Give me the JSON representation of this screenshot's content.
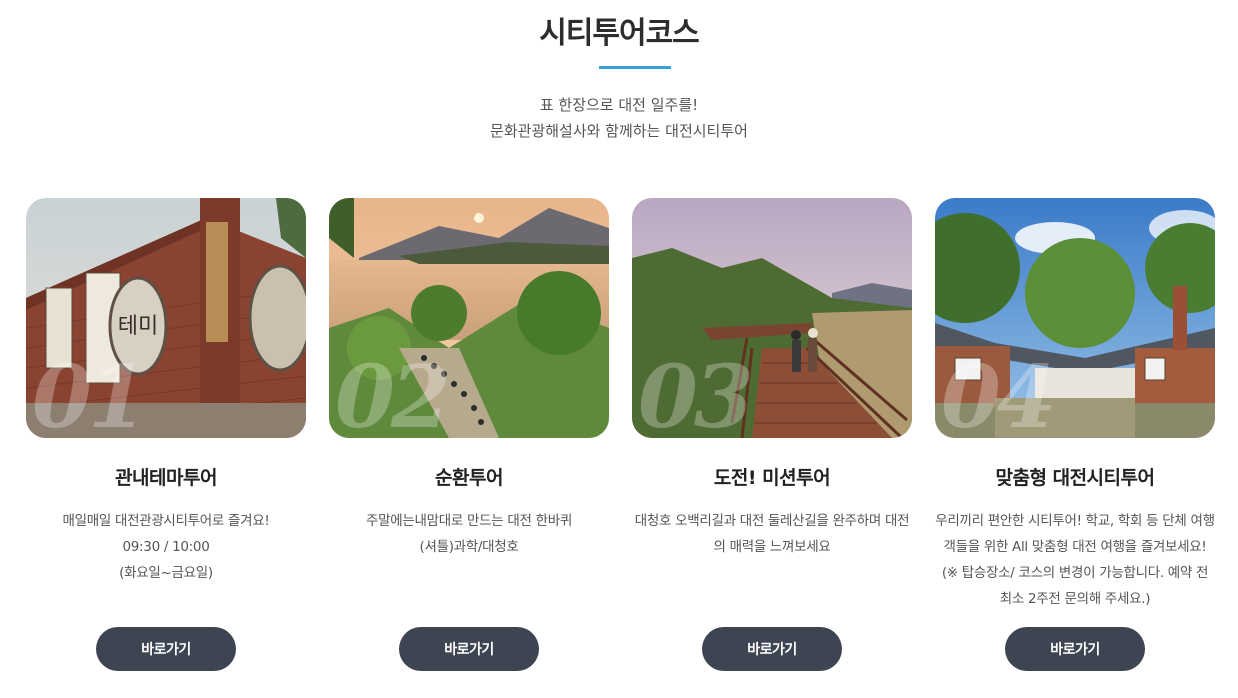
{
  "section": {
    "title": "시티투어코스",
    "subtitle_line1": "표 한장으로 대전 일주를!",
    "subtitle_line2": "문화관광해설사와 함께하는 대전시티투어"
  },
  "accent_color": "#3aa0de",
  "button_color": "#3d4452",
  "courses": [
    {
      "number": "01",
      "title": "관내테마투어",
      "desc": [
        "매일매일 대전관광시티투어로 즐겨요!",
        "09:30 / 10:00",
        "(화요일~금요일)"
      ],
      "button": "바로가기"
    },
    {
      "number": "02",
      "title": "순환투어",
      "desc": [
        "주말에는내맘대로 만드는 대전 한바퀴",
        "(셔틀)과학/대청호"
      ],
      "button": "바로가기"
    },
    {
      "number": "03",
      "title": "도전! 미션투어",
      "desc": [
        "대청호 오백리길과 대전 둘레산길을 완주하며 대전",
        "의 매력을 느껴보세요"
      ],
      "button": "바로가기"
    },
    {
      "number": "04",
      "title": "맞춤형 대전시티투어",
      "desc": [
        "우리끼리 편안한 시티투어! 학교, 학회 등 단체 여행",
        "객들을 위한 All 맞춤형 대전 여행을 즐겨보세요!",
        "(※ 탑승장소/ 코스의 변경이 가능합니다. 예약 전",
        "최소 2주전 문의해 주세요.)"
      ],
      "button": "바로가기"
    }
  ]
}
